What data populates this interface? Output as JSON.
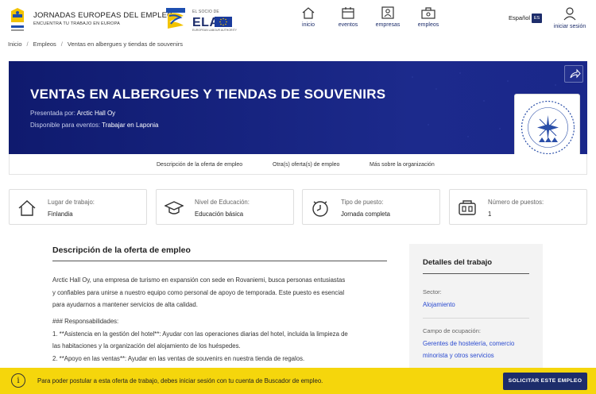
{
  "header": {
    "brand_title": "JORNADAS EUROPEAS DEL EMPLEO",
    "brand_subtitle": "ENCUENTRA TU TRABAJO EN EUROPA",
    "eures_label": "EURES",
    "partner_label": "EL SOCIO DE",
    "ela_label": "ELA",
    "ela_subtitle": "EUROPEAN LABOUR AUTHORITY",
    "nav": [
      {
        "label": "inicio",
        "icon": "home-icon"
      },
      {
        "label": "eventos",
        "icon": "calendar-icon"
      },
      {
        "label": "empresas",
        "icon": "companies-icon"
      },
      {
        "label": "empleos",
        "icon": "briefcase-icon"
      }
    ],
    "language": "Español",
    "language_code": "ES",
    "login_label": "iniciar sesión"
  },
  "breadcrumb": [
    "Inicio",
    "Empleos",
    "Ventas en albergues y tiendas de souvenirs"
  ],
  "hero": {
    "title": "VENTAS EN ALBERGUES Y TIENDAS DE SOUVENIRS",
    "presented_by_label": "Presentada por:",
    "presented_by": "Arctic Hall Oy",
    "available_label": "Disponible para eventos:",
    "available_event": "Trabajar en Laponia",
    "company_logo_text_top": "ROVANIEMI",
    "company_logo_text_bottom": "SUOMI / FINLAND"
  },
  "tabs": [
    "Descripción de la oferta de empleo",
    "Otra(s) oferta(s) de empleo",
    "Más sobre la organización"
  ],
  "cards": [
    {
      "label": "Lugar de trabajo:",
      "value": "Finlandia",
      "icon": "house-icon"
    },
    {
      "label": "Nivel de Educación:",
      "value": "Educación básica",
      "icon": "graduation-cap-icon"
    },
    {
      "label": "Tipo de puesto:",
      "value": "Jornada completa",
      "icon": "clock-icon"
    },
    {
      "label": "Número de puestos:",
      "value": "1",
      "icon": "desk-icon"
    }
  ],
  "description": {
    "title": "Descripción de la oferta de empleo",
    "paragraph1_line1": "Arctic Hall Oy, una empresa de turismo en expansión con sede en Rovaniemi, busca personas entusiastas",
    "paragraph1_line2": "y confiables para unirse a nuestro equipo como personal de apoyo de temporada. Este puesto es esencial",
    "paragraph1_line3": "para ayudarnos a mantener servicios de alta calidad.",
    "heading": "### Responsabilidades:",
    "item1_line1": "1. **Asistencia en la gestión del hotel**: Ayudar con las operaciones diarias del hotel, incluida la limpieza de",
    "item1_line2": "las habitaciones y la organización del alojamiento de los huéspedes.",
    "item2": "2. **Apoyo en las ventas**: Ayudar en las ventas de souvenirs en nuestra tienda de regalos."
  },
  "sidebar": {
    "title": "Detalles del trabajo",
    "sector_label": "Sector:",
    "sector_value": "Alojamiento",
    "field_label": "Campo de ocupación:",
    "field_value": "Gerentes de hostelería, comercio minorista y otros servicios"
  },
  "banner": {
    "text": "Para poder postular a esta oferta de trabajo, debes iniciar sesión con tu cuenta de Buscador de empleo.",
    "button": "SOLICITAR ESTE EMPLEO"
  },
  "colors": {
    "brand_navy": "#1d2d6b",
    "hero_blue": "#15217a",
    "banner_yellow": "#f5d60c",
    "link_blue": "#2b4bd0"
  }
}
